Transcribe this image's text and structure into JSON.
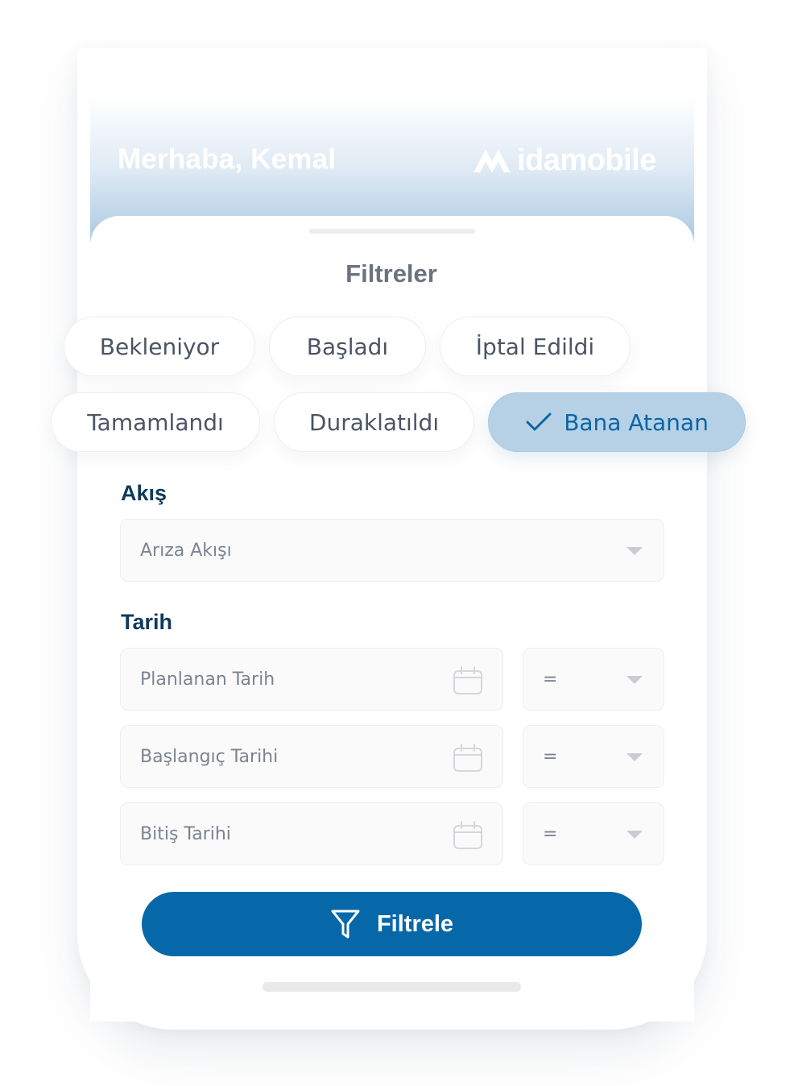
{
  "header": {
    "greeting": "Merhaba, Kemal",
    "brand": "idamobile"
  },
  "sheet": {
    "title": "Filtreler"
  },
  "chips": [
    {
      "label": "Bekleniyor",
      "active": false
    },
    {
      "label": "Başladı",
      "active": false
    },
    {
      "label": "İptal Edildi",
      "active": false
    },
    {
      "label": "Tamamlandı",
      "active": false
    },
    {
      "label": "Duraklatıldı",
      "active": false
    },
    {
      "label": "Bana Atanan",
      "active": true
    }
  ],
  "flow": {
    "label": "Akış",
    "value": "Arıza Akışı"
  },
  "date": {
    "label": "Tarih",
    "fields": [
      {
        "placeholder": "Planlanan Tarih",
        "operator": "="
      },
      {
        "placeholder": "Başlangıç Tarihi",
        "operator": "="
      },
      {
        "placeholder": "Bitiş Tarihi",
        "operator": "="
      }
    ]
  },
  "actions": {
    "filter_label": "Filtrele"
  },
  "colors": {
    "primary": "#0668a8",
    "active_chip": "#b6d1e6",
    "label": "#0e3a5c"
  }
}
